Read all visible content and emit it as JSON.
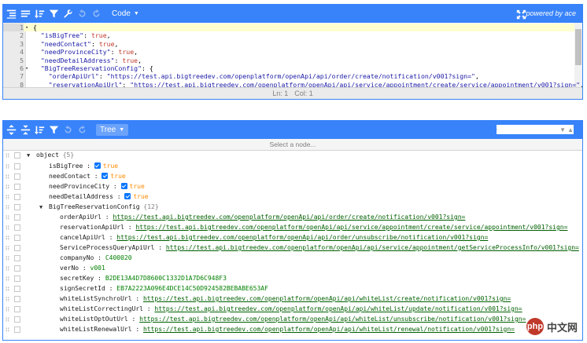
{
  "code_editor": {
    "mode_label": "Code",
    "powered_by": "powered by ace",
    "lines": [
      {
        "n": "1",
        "fold": "▾",
        "text": "{"
      },
      {
        "n": "2",
        "fold": "",
        "key": "\"isBigTree\"",
        "val": "true",
        "type": "bool"
      },
      {
        "n": "3",
        "fold": "",
        "key": "\"needContact\"",
        "val": "true",
        "type": "bool"
      },
      {
        "n": "4",
        "fold": "",
        "key": "\"needProvinceCity\"",
        "val": "true",
        "type": "bool"
      },
      {
        "n": "5",
        "fold": "",
        "key": "\"needDetailAddress\"",
        "val": "true",
        "type": "bool"
      },
      {
        "n": "6",
        "fold": "▾",
        "key": "\"BigTreeReservationConfig\"",
        "val": "{",
        "type": "obj"
      },
      {
        "n": "7",
        "fold": "",
        "key": "\"orderApiUrl\"",
        "val": "\"https://test.api.bigtreedev.com/openplatform/openApi/api/order/create/notification/v001?sign=\"",
        "type": "str"
      },
      {
        "n": "8",
        "fold": "",
        "key": "\"reservationApiUrl\"",
        "val": "\"https://test.api.bigtreedev.com/openplatform/openApi/api/service/appointment/create/service/appointment/v001?sign=\"",
        "type": "str"
      }
    ],
    "status": {
      "ln": "Ln: 1",
      "col": "Col: 1"
    }
  },
  "tree_editor": {
    "mode_label": "Tree",
    "navbar_text": "Select a node...",
    "search_placeholder": "",
    "root": {
      "label": "object",
      "count": "{5}"
    },
    "rows": [
      {
        "field": "isBigTree",
        "type": "bool",
        "value": "true",
        "indent": 1
      },
      {
        "field": "needContact",
        "type": "bool",
        "value": "true",
        "indent": 1
      },
      {
        "field": "needProvinceCity",
        "type": "bool",
        "value": "true",
        "indent": 1
      },
      {
        "field": "needDetailAddress",
        "type": "bool",
        "value": "true",
        "indent": 1
      },
      {
        "field": "BigTreeReservationConfig",
        "type": "obj",
        "value": "{12}",
        "indent": 1,
        "expanded": true
      },
      {
        "field": "orderApiUrl",
        "type": "url",
        "value": "https://test.api.bigtreedev.com/openplatform/openApi/api/order/create/notification/v001?sign=",
        "indent": 2
      },
      {
        "field": "reservationApiUrl",
        "type": "url",
        "value": "https://test.api.bigtreedev.com/openplatform/openApi/api/service/appointment/create/service/appointment/v001?sign=",
        "indent": 2
      },
      {
        "field": "cancelApiUrl",
        "type": "url",
        "value": "https://test.api.bigtreedev.com/openplatform/openApi/api/order/unsubscribe/notification/v001?sign=",
        "indent": 2
      },
      {
        "field": "ServiceProcessQueryApiUrl",
        "type": "url",
        "value": "https://test.api.bigtreedev.com/openplatform/openApi/api/service/appointment/getServiceProcessInfo/v001?sign=",
        "indent": 2
      },
      {
        "field": "companyNo",
        "type": "str",
        "value": "C400020",
        "indent": 2
      },
      {
        "field": "verNo",
        "type": "str",
        "value": "v001",
        "indent": 2
      },
      {
        "field": "secretKey",
        "type": "str",
        "value": "B2DE13A4D7D8600C1332D1A7D6C948F3",
        "indent": 2
      },
      {
        "field": "signSecretId",
        "type": "str",
        "value": "EB7A2223A096E4DCE14C50D924582BEBABE653AF",
        "indent": 2
      },
      {
        "field": "whiteListSynchroUrl",
        "type": "url",
        "value": "https://test.api.bigtreedev.com/openplatform/openApi/api/whiteList/create/notification/v001?sign=",
        "indent": 2
      },
      {
        "field": "whiteListCorrectingUrl",
        "type": "url",
        "value": "https://test.api.bigtreedev.com/openplatform/openApi/api/whiteList/update/notification/v001?sign=",
        "indent": 2
      },
      {
        "field": "whiteListOptOutUrl",
        "type": "url",
        "value": "https://test.api.bigtreedev.com/openplatform/openApi/api/whiteList/unsubscribe/notification/v001?sign=",
        "indent": 2
      },
      {
        "field": "whiteListRenewalUrl",
        "type": "url",
        "value": "https://test.api.bigtreedev.com/openplatform/openApi/api/whiteList/renewal/notification/v001?sign=",
        "indent": 2
      }
    ]
  },
  "watermark": {
    "text": "中文网",
    "logo": "php"
  },
  "colors": {
    "accent": "#3883fa",
    "bool": "#ff8c00",
    "url": "#006000",
    "string": "#008000"
  },
  "icons": [
    "format-icon",
    "compact-icon",
    "sort-icon",
    "filter-icon",
    "repair-icon",
    "undo-icon",
    "redo-icon",
    "fullscreen-icon",
    "expand-all-icon",
    "collapse-all-icon",
    "search-icon"
  ]
}
